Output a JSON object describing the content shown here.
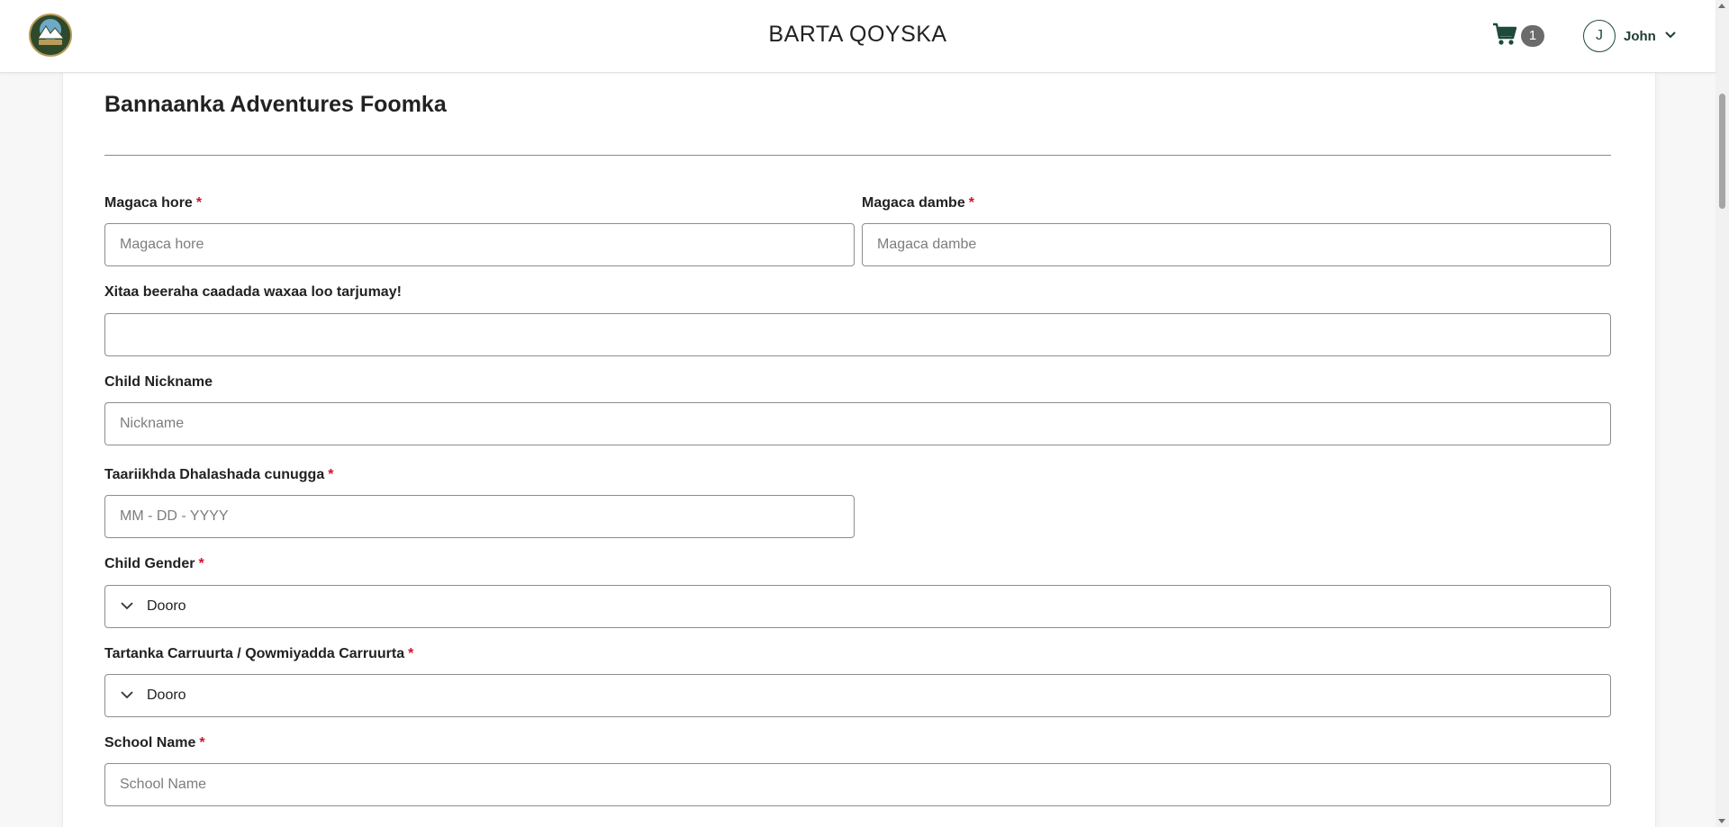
{
  "header": {
    "site_title": "BARTA QOYSKA",
    "cart_count": "1",
    "user_initial": "J",
    "user_name": "John"
  },
  "form": {
    "title": "Bannaanka Adventures Foomka",
    "required_mark": "*",
    "first_name": {
      "label": "Magaca hore",
      "placeholder": "Magaca hore",
      "value": ""
    },
    "last_name": {
      "label": "Magaca dambe",
      "placeholder": "Magaca dambe",
      "value": ""
    },
    "translate_note": {
      "label": "Xitaa beeraha caadada waxaa loo tarjumay!",
      "value": ""
    },
    "nickname": {
      "label": "Child Nickname",
      "placeholder": "Nickname",
      "value": ""
    },
    "birth_date": {
      "label": "Taariikhda Dhalashada cunugga",
      "placeholder": "MM - DD - YYYY",
      "value": ""
    },
    "gender": {
      "label": "Child Gender",
      "selected": "Dooro"
    },
    "grade": {
      "label": "Tartanka Carruurta / Qowmiyadda Carruurta",
      "selected": "Dooro"
    },
    "school": {
      "label": "School Name",
      "placeholder": "School Name",
      "value": ""
    }
  },
  "colors": {
    "brand_dark_green": "#1e4a3c",
    "required_red": "#d0142c",
    "logo_green": "#2f4a2a"
  },
  "icons": {
    "cart": "shopping-cart-icon",
    "user_menu": "chevron-down-icon",
    "select": "chevron-down-icon"
  }
}
